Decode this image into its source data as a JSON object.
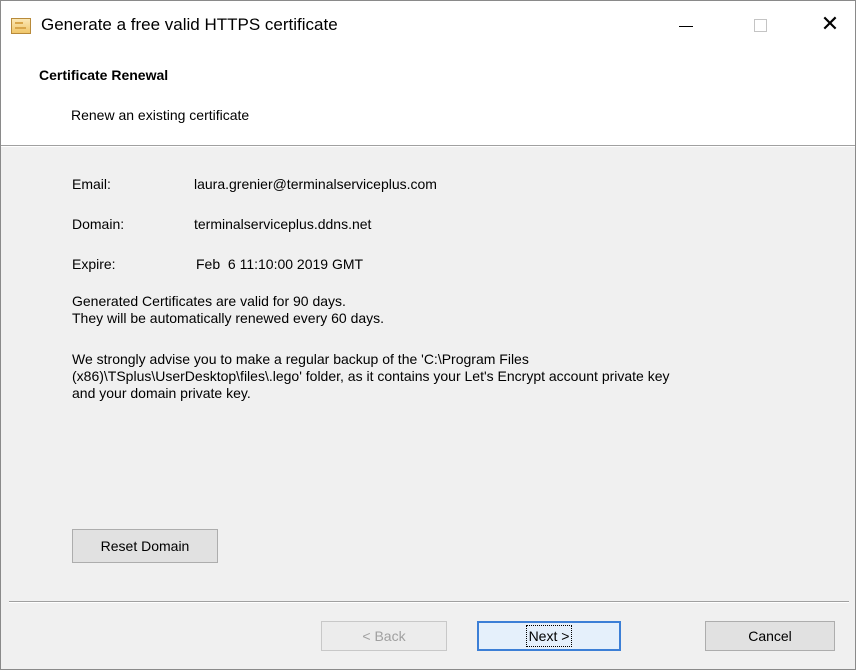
{
  "window": {
    "title": "Generate a free valid HTTPS certificate",
    "icon": "certificate-app-icon"
  },
  "header": {
    "title": "Certificate Renewal",
    "subtitle": "Renew an existing certificate"
  },
  "details": {
    "email_label": "Email:",
    "email_value": "laura.grenier@terminalserviceplus.com",
    "domain_label": "Domain:",
    "domain_value": "terminalserviceplus.ddns.net",
    "expire_label": "Expire:",
    "expire_value": "Feb  6 11:10:00 2019 GMT"
  },
  "info": {
    "validity_line1": "Generated Certificates are valid for 90 days.",
    "validity_line2": "They will be automatically renewed every 60 days.",
    "backup_line1": "We strongly advise you to make a regular backup of the 'C:\\Program Files",
    "backup_line2": "(x86)\\TSplus\\UserDesktop\\files\\.lego' folder, as it contains your Let's Encrypt account private key",
    "backup_line3": "and your domain private key."
  },
  "buttons": {
    "reset_domain": "Reset Domain",
    "back": "< Back",
    "next": "Next >",
    "cancel": "Cancel"
  }
}
